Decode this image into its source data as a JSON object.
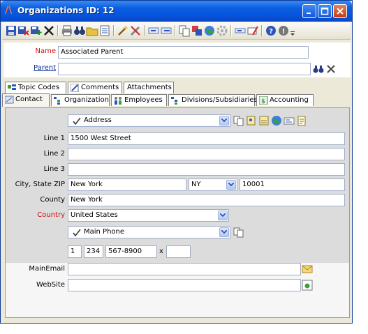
{
  "window": {
    "title": "Organizations ID: 12"
  },
  "header": {
    "name_label": "Name",
    "name_value": "Associated Parent",
    "parent_label": "Parent",
    "parent_value": ""
  },
  "tabs_row1": [
    {
      "label": "Topic Codes",
      "icon": "topic-codes-icon"
    },
    {
      "label": "Comments",
      "icon": "comments-icon"
    },
    {
      "label": "Attachments",
      "icon": "attachments-icon"
    }
  ],
  "tabs_row2": [
    {
      "label": "Contact",
      "icon": "contact-icon",
      "active": true
    },
    {
      "label": "Organization",
      "icon": "organization-icon"
    },
    {
      "label": "Employees",
      "icon": "employees-icon"
    },
    {
      "label": "Divisions/Subsidiaries",
      "icon": "divisions-icon"
    },
    {
      "label": "Accounting",
      "icon": "accounting-icon"
    }
  ],
  "contact": {
    "address_type": "Address",
    "line1_label": "Line 1",
    "line1": "1500 West Street",
    "line2_label": "Line 2",
    "line2": "",
    "line3_label": "Line 3",
    "line3": "",
    "city_label": "City, State ZIP",
    "city": "New York",
    "state": "NY",
    "zip": "10001",
    "county_label": "County",
    "county": "New York",
    "country_label": "Country",
    "country": "United States",
    "phone_type": "Main Phone",
    "phone_country": "1",
    "phone_area": "234",
    "phone_number": "567-8900",
    "phone_ext_label": "x",
    "phone_ext": "",
    "email_label": "MainEmail",
    "email": "",
    "website_label": "WebSite",
    "website": ""
  },
  "colors": {
    "title_bar": "#0654dd",
    "required_label": "#d01010",
    "link_label": "#0b2e9c"
  }
}
